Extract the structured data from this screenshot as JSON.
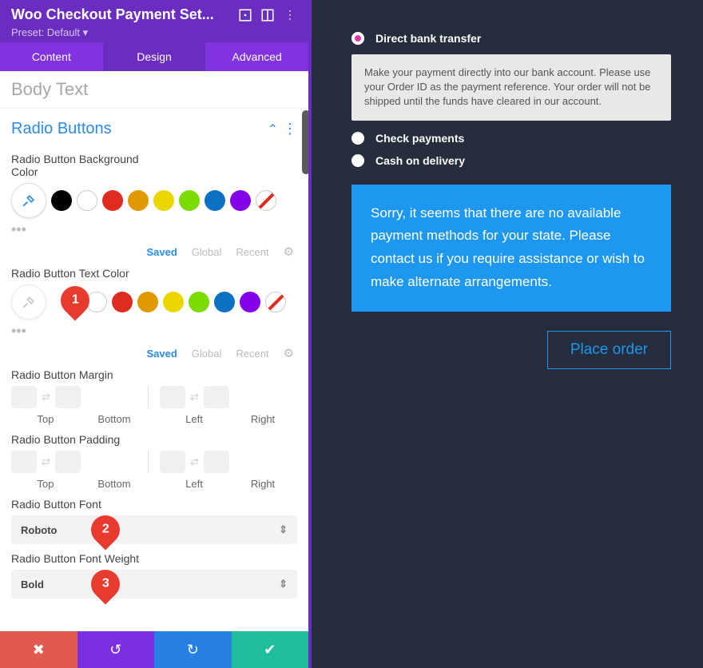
{
  "header": {
    "title": "Woo Checkout Payment Set...",
    "preset": "Preset: Default"
  },
  "tabs": {
    "content": "Content",
    "design": "Design",
    "advanced": "Advanced"
  },
  "ghost_section": "Body Text",
  "section": {
    "title": "Radio Buttons"
  },
  "opt1_label": "Radio Button Background Color",
  "opt2_label": "Radio Button Text Color",
  "tabset": {
    "saved": "Saved",
    "global": "Global",
    "recent": "Recent"
  },
  "margin_label": "Radio Button Margin",
  "padding_label": "Radio Button Padding",
  "sides": {
    "top": "Top",
    "bottom": "Bottom",
    "left": "Left",
    "right": "Right"
  },
  "font_label": "Radio Button Font",
  "font_value": "Roboto",
  "weight_label": "Radio Button Font Weight",
  "weight_value": "Bold",
  "callouts": {
    "c1": "1",
    "c2": "2",
    "c3": "3"
  },
  "preview": {
    "opt1": "Direct bank transfer",
    "opt2": "Check payments",
    "opt3": "Cash on delivery",
    "info": "Make your payment directly into our bank account. Please use your Order ID as the payment reference. Your order will not be shipped until the funds have cleared in our account.",
    "msg": "Sorry, it seems that there are no available payment methods for your state. Please contact us if you require assistance or wish to make alternate arrangements.",
    "button": "Place order"
  }
}
